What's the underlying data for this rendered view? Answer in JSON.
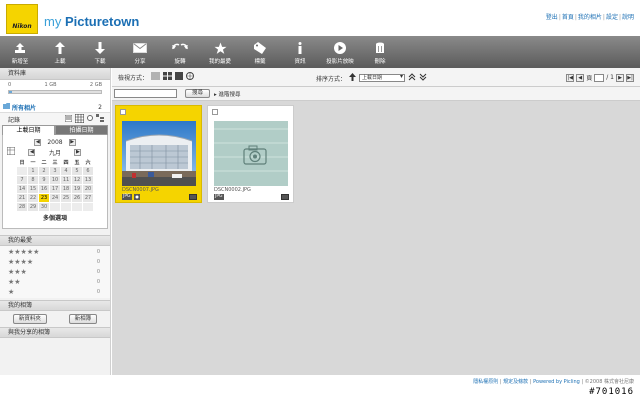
{
  "brand": {
    "logo_text": "Nikon",
    "name_prefix": "my ",
    "name_main": "Picturetown"
  },
  "top_links": [
    "登出",
    "首頁",
    "我的相片",
    "設定",
    "說明"
  ],
  "toolbar": [
    {
      "label": "新增至",
      "icon": "upload-arrow-icon"
    },
    {
      "label": "上載",
      "icon": "up-arrow-icon"
    },
    {
      "label": "下載",
      "icon": "down-arrow-icon"
    },
    {
      "label": "分享",
      "icon": "envelope-icon"
    },
    {
      "label": "旋轉",
      "icon": "rotate-icon"
    },
    {
      "label": "我的最愛",
      "icon": "star-icon"
    },
    {
      "label": "標籤",
      "icon": "tag-icon"
    },
    {
      "label": "資訊",
      "icon": "info-icon"
    },
    {
      "label": "投影片放映",
      "icon": "play-icon"
    },
    {
      "label": "刪除",
      "icon": "trash-icon"
    }
  ],
  "sidebar": {
    "library_title": "資料庫",
    "storage": {
      "scale": [
        "0",
        "1 GB",
        "2 GB"
      ],
      "used_fraction": 0.03
    },
    "all_photos": {
      "label": "所有相片",
      "count": "2"
    },
    "records_label": "記錄",
    "tabs": [
      "上載日期",
      "拍攝日期"
    ],
    "calendar": {
      "year": "2008",
      "month": "九月",
      "weekdays": [
        "日",
        "一",
        "二",
        "三",
        "四",
        "五",
        "六"
      ],
      "weeks": [
        [
          "",
          "1",
          "2",
          "3",
          "4",
          "5",
          "6"
        ],
        [
          "7",
          "8",
          "9",
          "10",
          "11",
          "12",
          "13"
        ],
        [
          "14",
          "15",
          "16",
          "17",
          "18",
          "19",
          "20"
        ],
        [
          "21",
          "22",
          "23",
          "24",
          "25",
          "26",
          "27"
        ],
        [
          "28",
          "29",
          "30",
          "",
          "",
          "",
          ""
        ]
      ],
      "selected": "23",
      "multi_select_label": "多個選項"
    },
    "favorites_title": "我的最愛",
    "favorites": [
      {
        "stars": "★★★★★",
        "count": "0"
      },
      {
        "stars": "★★★★",
        "count": "0"
      },
      {
        "stars": "★★★",
        "count": "0"
      },
      {
        "stars": "★★",
        "count": "0"
      },
      {
        "stars": "★",
        "count": "0"
      }
    ],
    "albums_title": "我的相簿",
    "new_folder_label": "新資料夾",
    "new_album_label": "新相簿",
    "shared_title": "與我分享的相簿"
  },
  "main": {
    "view_mode_label": "檢視方式：",
    "sort_label": "排序方式：",
    "sort_value": "上載日期",
    "page_current": "1",
    "page_total_text": "/ 1",
    "search_placeholder": "",
    "search_button": "搜尋",
    "advanced_search": "▸ 進階搜尋",
    "photos": [
      {
        "filename": "DSCN0007.JPG",
        "badge": "JPG",
        "selected": true
      },
      {
        "filename": "DSCN0002.JPG",
        "badge": "JPG",
        "selected": false
      }
    ]
  },
  "footer": {
    "links": [
      "隱私權原則",
      "規定及條款"
    ],
    "powered": "Powered by Picling",
    "copyright": "©2008 株式會社尼康"
  },
  "watermark": "#701016",
  "colors": {
    "accent_yellow": "#f5d400",
    "link_blue": "#1b6fb4",
    "toolbar_gray": "#6e6e6e"
  }
}
